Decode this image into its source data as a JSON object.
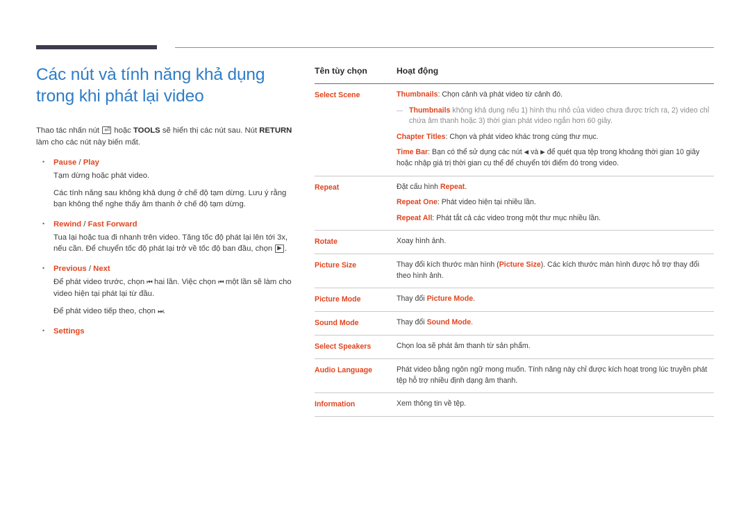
{
  "document": {
    "title": "Các nút và tính năng khả dụng trong khi phát lại video",
    "title_line1": "Các nút và tính năng khả dụng",
    "title_line2": "trong khi phát lại video",
    "accent_bar_color": "#3f3a4e",
    "title_color": "#2f7dc6",
    "keyword_color": "#e0451f",
    "body_color": "#3c3c3c",
    "note_color": "#8c8c8c"
  },
  "intro": {
    "part1": "Thao tác nhấn nút ",
    "enter_key_icon": "enter-key-icon",
    "part2": " hoặc ",
    "tools_label": "TOOLS",
    "part3": " sẽ hiển thị các nút sau. Nút ",
    "return_label": "RETURN",
    "part4": " làm cho các nút này biến mất."
  },
  "bullets": [
    {
      "head_first": "Pause",
      "head_sep": " / ",
      "head_second": "Play",
      "lines": [
        "Tạm dừng hoặc phát video.",
        "Các tính năng sau không khả dụng ở chế độ tạm dừng. Lưu ý rằng bạn không thể nghe thấy âm thanh ở chế độ tạm dừng."
      ]
    },
    {
      "head_first": "Rewind",
      "head_sep": " / ",
      "head_second": "Fast Forward",
      "lines_rich": {
        "text_before": "Tua lại hoặc tua đi nhanh trên video. Tăng tốc độ phát lại lên tới 3x, nếu cần. Để chuyển tốc độ phát lại trở về tốc độ ban đầu, chọn ",
        "icon": "play-button-icon",
        "text_after": "."
      }
    },
    {
      "head_first": "Previous",
      "head_sep": " / ",
      "head_second": "Next",
      "lines_rich2": {
        "p1_a": "Để phát video trước, chọn ",
        "p1_icon1": "skip-previous-icon",
        "p1_b": " hai lần. Việc chọn ",
        "p1_icon2": "skip-previous-icon",
        "p1_c": " một lần sẽ làm cho video hiện tại phát lại từ đầu.",
        "p2_a": "Để phát video tiếp theo, chọn ",
        "p2_icon": "skip-next-icon",
        "p2_b": "."
      }
    },
    {
      "head_first": "Settings",
      "head_sep": "",
      "head_second": "",
      "lines": []
    }
  ],
  "table": {
    "header": {
      "col_name": "Tên tùy chọn",
      "col_action": "Hoạt động"
    },
    "rows": [
      {
        "name": "Select Scene",
        "paragraphs": [
          {
            "type": "normal",
            "kw": "Thumbnails",
            "text": ": Chọn cảnh và phát video từ cảnh đó."
          },
          {
            "type": "note",
            "kw": "Thumbnails",
            "text": " không khả dụng nếu 1) hình thu nhỏ của video chưa được trích ra, 2) video chỉ chứa âm thanh hoặc 3) thời gian phát video ngắn hơn 60 giây."
          },
          {
            "type": "normal",
            "kw": "Chapter Titles",
            "text": ": Chọn và phát video khác trong cùng thư mục."
          },
          {
            "type": "timebar",
            "kw": "Time Bar",
            "text_a": ": Bạn có thể sử dụng các nút ",
            "icon_left": "arrow-left-icon",
            "text_b": " và ",
            "icon_right": "arrow-right-icon",
            "text_c": " để quét qua tệp trong khoảng thời gian 10 giây hoặc nhập giá trị thời gian cụ thể để chuyển tới điểm đó trong video."
          }
        ]
      },
      {
        "name": "Repeat",
        "paragraphs": [
          {
            "type": "suffix",
            "prefix": "Đặt cấu hình ",
            "kw": "Repeat",
            "text": "."
          },
          {
            "type": "normal",
            "kw": "Repeat One",
            "text": ": Phát video hiện tại nhiều lần."
          },
          {
            "type": "normal",
            "kw": "Repeat All",
            "text": ": Phát tắt cả các video trong một thư mục nhiều lần."
          }
        ]
      },
      {
        "name": "Rotate",
        "paragraphs": [
          {
            "type": "plain",
            "text": "Xoay hình ảnh."
          }
        ]
      },
      {
        "name": "Picture Size",
        "paragraphs": [
          {
            "type": "mid",
            "prefix": "Thay đổi kích thước màn hình (",
            "kw": "Picture Size",
            "text": "). Các kích thước màn hình được hỗ trợ thay đổi theo hình ảnh."
          }
        ]
      },
      {
        "name": "Picture Mode",
        "paragraphs": [
          {
            "type": "suffix",
            "prefix": "Thay đổi ",
            "kw": "Picture Mode",
            "text": "."
          }
        ]
      },
      {
        "name": "Sound Mode",
        "paragraphs": [
          {
            "type": "suffix",
            "prefix": "Thay đổi ",
            "kw": "Sound Mode",
            "text": "."
          }
        ]
      },
      {
        "name": "Select Speakers",
        "paragraphs": [
          {
            "type": "plain",
            "text": "Chọn loa sẽ phát âm thanh từ sản phẩm."
          }
        ]
      },
      {
        "name": "Audio Language",
        "paragraphs": [
          {
            "type": "plain",
            "text": "Phát video bằng ngôn ngữ mong muốn. Tính năng này chỉ được kích hoạt trong lúc truyền phát tệp hỗ trợ nhiều định dạng âm thanh."
          }
        ]
      },
      {
        "name": "Information",
        "paragraphs": [
          {
            "type": "plain",
            "text": "Xem thông tin về tệp."
          }
        ]
      }
    ]
  }
}
